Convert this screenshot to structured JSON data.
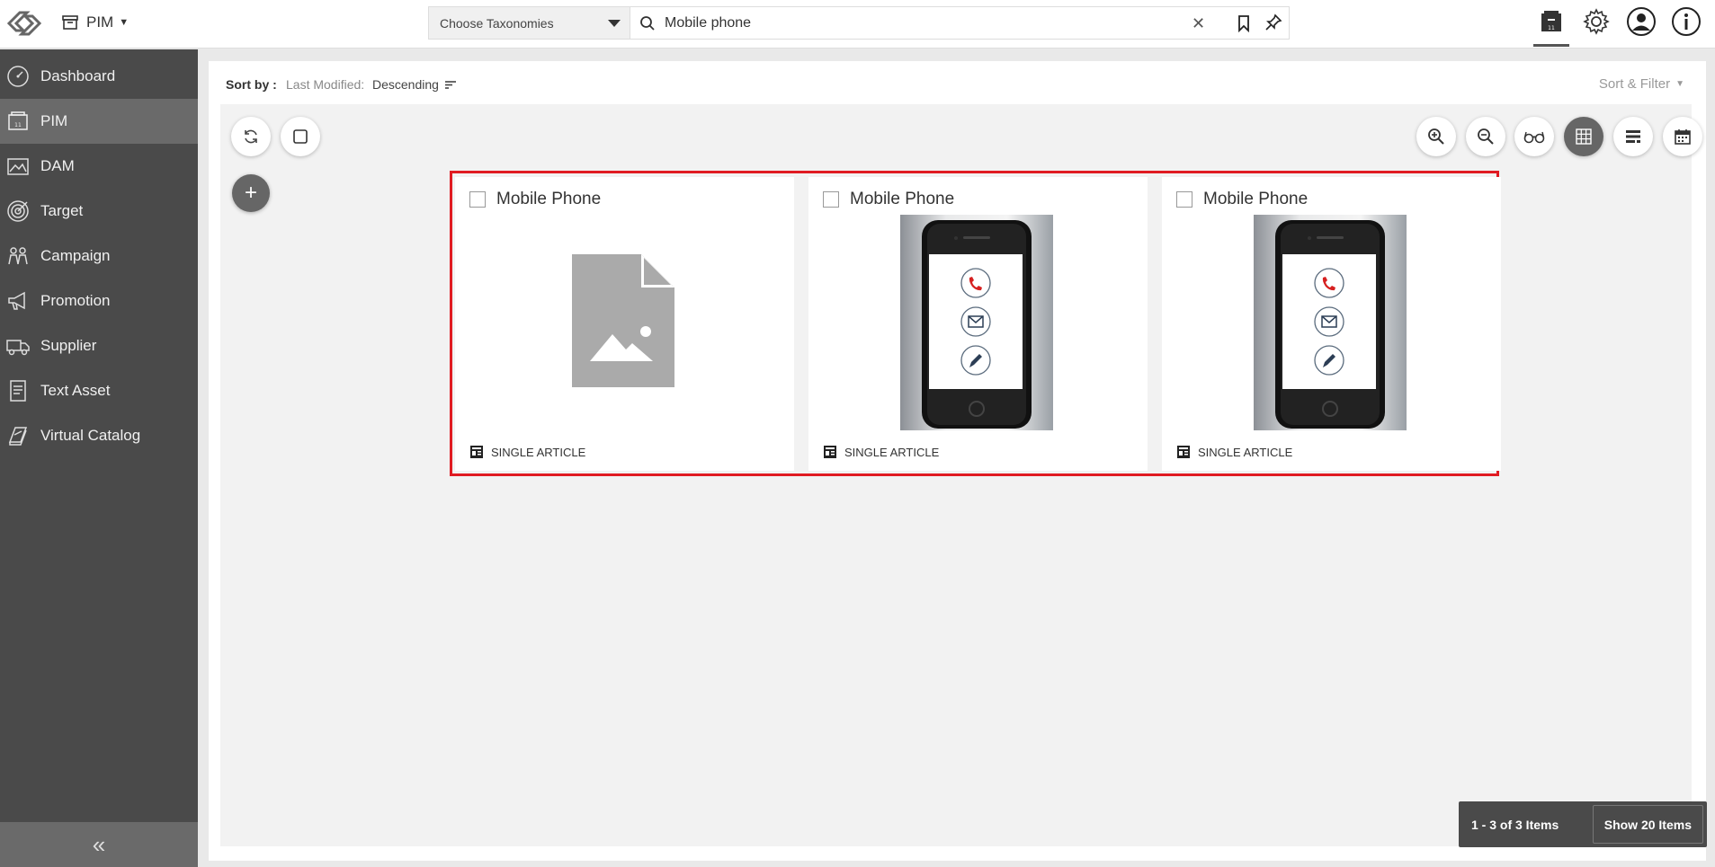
{
  "header": {
    "module_label": "PIM",
    "taxonomy_placeholder": "Choose Taxonomies",
    "search_value": "Mobile phone"
  },
  "sidebar": {
    "items": [
      {
        "label": "Dashboard",
        "icon": "dashboard-icon"
      },
      {
        "label": "PIM",
        "icon": "pim-icon",
        "active": true
      },
      {
        "label": "DAM",
        "icon": "image-icon"
      },
      {
        "label": "Target",
        "icon": "target-icon"
      },
      {
        "label": "Campaign",
        "icon": "campaign-icon"
      },
      {
        "label": "Promotion",
        "icon": "megaphone-icon"
      },
      {
        "label": "Supplier",
        "icon": "truck-icon"
      },
      {
        "label": "Text Asset",
        "icon": "text-asset-icon"
      },
      {
        "label": "Virtual Catalog",
        "icon": "catalog-icon"
      }
    ],
    "collapse_glyph": "«"
  },
  "sortbar": {
    "label": "Sort by :",
    "field": "Last Modified:",
    "direction": "Descending",
    "filter_label": "Sort & Filter"
  },
  "cards": [
    {
      "title": "Mobile Phone",
      "type": "SINGLE ARTICLE",
      "image": "placeholder-image-icon"
    },
    {
      "title": "Mobile Phone",
      "type": "SINGLE ARTICLE",
      "image": "mobile-phone-image"
    },
    {
      "title": "Mobile Phone",
      "type": "SINGLE ARTICLE",
      "image": "mobile-phone-image"
    }
  ],
  "pager": {
    "count": "1 - 3 of 3 Items",
    "show_label": "Show 20 Items"
  },
  "colors": {
    "sidebar_bg": "#4a4a4a",
    "sidebar_active": "#6a6a6a",
    "highlight_border": "#e01b22"
  }
}
